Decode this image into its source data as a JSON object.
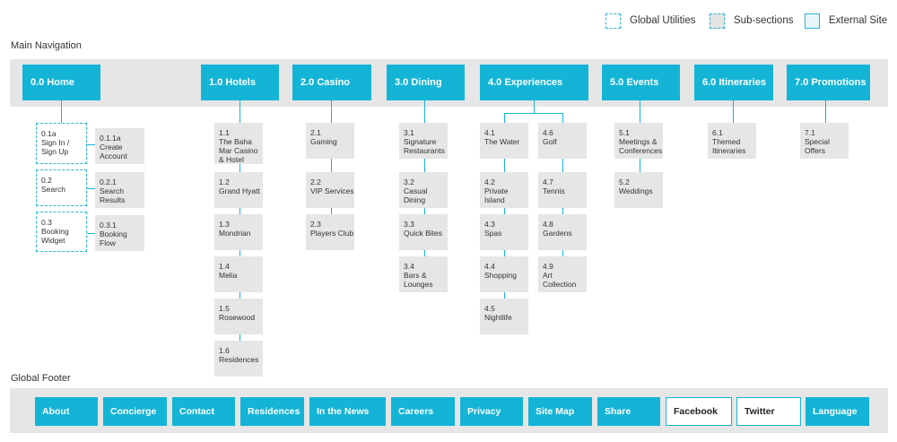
{
  "legend": {
    "global": "Global Utilities",
    "sub": "Sub-sections",
    "external": "External Site"
  },
  "main_nav_label": "Main Navigation",
  "footer_label": "Global Footer",
  "nav": [
    {
      "label": "0.0  Home"
    },
    {
      "label": "1.0  Hotels"
    },
    {
      "label": "2.0 Casino"
    },
    {
      "label": "3.0 Dining"
    },
    {
      "label": "4.0 Experiences"
    },
    {
      "label": "5.0 Events"
    },
    {
      "label": "6.0 Itineraries"
    },
    {
      "label": "7.0 Promotions"
    }
  ],
  "home_utilities": [
    {
      "num": "0.1a",
      "label": "Sign In / Sign Up",
      "child": {
        "num": "0.1.1a",
        "label": "Create Account"
      }
    },
    {
      "num": "0.2",
      "label": "Search",
      "child": {
        "num": "0.2.1",
        "label": "Search Results"
      }
    },
    {
      "num": "0.3",
      "label": "Booking Widget",
      "child": {
        "num": "0.3.1",
        "label": "Booking Flow"
      }
    }
  ],
  "hotels": [
    {
      "num": "1.1",
      "label": "The Baha Mar Casino & Hotel"
    },
    {
      "num": "1.2",
      "label": "Grand Hyatt"
    },
    {
      "num": "1.3",
      "label": "Mondrian"
    },
    {
      "num": "1.4",
      "label": "Melia"
    },
    {
      "num": "1.5",
      "label": "Rosewood"
    },
    {
      "num": "1.6",
      "label": "Residences"
    }
  ],
  "casino": [
    {
      "num": "2.1",
      "label": "Gaming"
    },
    {
      "num": "2.2",
      "label": "VIP Services"
    },
    {
      "num": "2.3",
      "label": "Players Club"
    }
  ],
  "dining": [
    {
      "num": "3.1",
      "label": "Signature Restaurants"
    },
    {
      "num": "3.2",
      "label": "Casual Dining"
    },
    {
      "num": "3.3",
      "label": "Quick Bites"
    },
    {
      "num": "3.4",
      "label": "Bars & Lounges"
    }
  ],
  "experiences_a": [
    {
      "num": "4.1",
      "label": "The Water"
    },
    {
      "num": "4.2",
      "label": "Private Island"
    },
    {
      "num": "4.3",
      "label": "Spas"
    },
    {
      "num": "4.4",
      "label": "Shopping"
    },
    {
      "num": "4.5",
      "label": "Nightlife"
    }
  ],
  "experiences_b": [
    {
      "num": "4.6",
      "label": "Golf"
    },
    {
      "num": "4.7",
      "label": "Tennis"
    },
    {
      "num": "4.8",
      "label": "Gardens"
    },
    {
      "num": "4.9",
      "label": "Art Collection"
    }
  ],
  "events": [
    {
      "num": "5.1",
      "label": "Meetings & Conferences"
    },
    {
      "num": "5.2",
      "label": "Weddings"
    }
  ],
  "itineraries": [
    {
      "num": "6.1",
      "label": "Themed Itineraries"
    }
  ],
  "promotions": [
    {
      "num": "7.1",
      "label": "Special Offers"
    }
  ],
  "footer": [
    {
      "label": "About"
    },
    {
      "label": "Concierge"
    },
    {
      "label": "Contact"
    },
    {
      "label": "Residences"
    },
    {
      "label": "In the News"
    },
    {
      "label": "Careers"
    },
    {
      "label": "Privacy"
    },
    {
      "label": "Site Map"
    },
    {
      "label": "Share"
    },
    {
      "label": "Facebook",
      "external": true
    },
    {
      "label": "Twitter",
      "external": true
    },
    {
      "label": "Language"
    }
  ]
}
